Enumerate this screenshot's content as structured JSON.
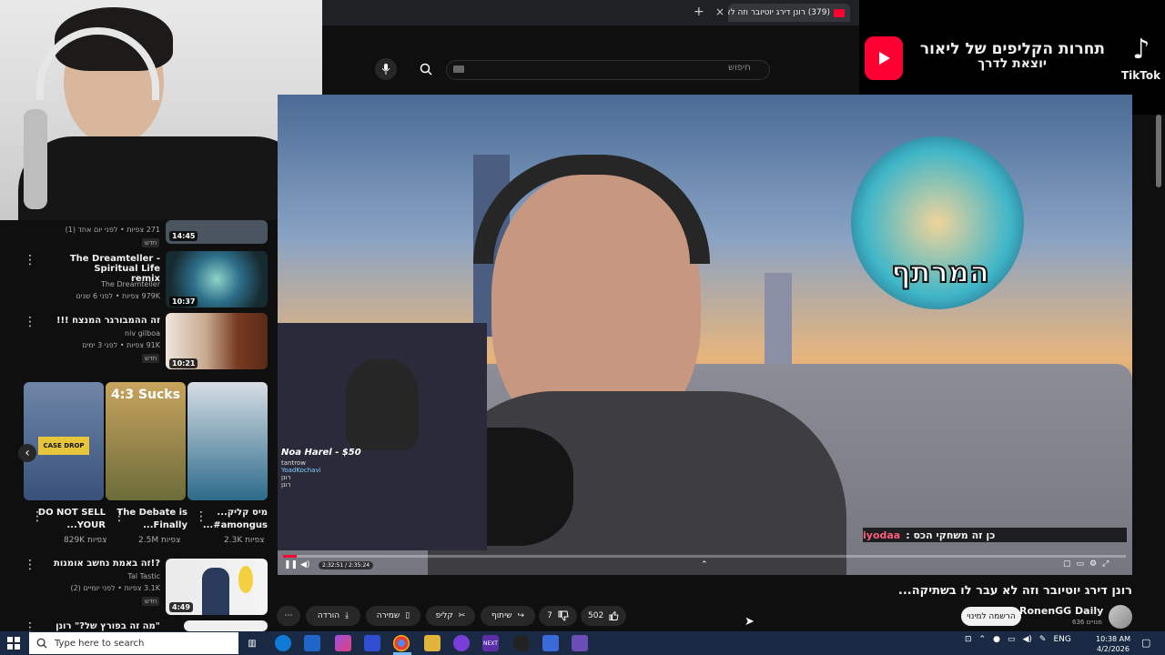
{
  "browser": {
    "tab_title": "(379) רונן דירג יוטיובר וזה לא",
    "tab_close": "×",
    "new_tab": "+"
  },
  "search": {
    "placeholder": "חיפוש"
  },
  "banner": {
    "line1": "תחרות הקליפים של ליאור",
    "line2": "יוצאת לדרך",
    "tiktok_label": "TikTok"
  },
  "sidebar": {
    "top_item": {
      "meta": "271 צפיות • לפני יום אחד (1)",
      "badge": "חדש",
      "duration": "14:45"
    },
    "items": [
      {
        "title_line1": "The Dreamteller - Spiritual Life",
        "title_line2": "remix",
        "channel": "The Dreamteller",
        "meta": "979K צפיות • לפני 6 שנים",
        "duration": "10:37"
      },
      {
        "title": "זה ההמבורגר המנצח !!!",
        "channel": "niv gilboa",
        "meta": "91K צפיות • לפני 3 ימים",
        "badge": "חדש",
        "duration": "10:21"
      },
      {
        "title": "?!זה באמת נחשב אומנות",
        "channel": "Tal Tastic",
        "meta": "3.1K צפיות • לפני יומיים (2)",
        "badge": "חדש",
        "duration": "4:49"
      },
      {
        "title": "\"מה זה בפורץ של?\" רונן מגיב"
      }
    ],
    "shorts": [
      {
        "title": "DO NOT SELL YOUR...",
        "views": "829K צפיות",
        "thumb_text": "CASE DROP"
      },
      {
        "title": "The Debate is Finally...",
        "views": "2.5M צפיות",
        "thumb_text": "4:3 Sucks"
      },
      {
        "title": "מיס קליק... amongus#...",
        "views": "2.3K צפיות",
        "thumb_text": ""
      }
    ],
    "shorts_prev": "‹"
  },
  "video": {
    "title": "רונן דירג יוטיובר וזה לא עבר לו בשתיקה...",
    "donation": "Noa Harel - $50",
    "mini_chat": [
      "tantrow",
      "YoadKochavi",
      "רונן",
      "רונן"
    ],
    "chat_user": "iyodaa",
    "chat_message": "כן זה משחקי הכס :",
    "time": "2:32:51 / 2:35:24",
    "progress_fraction": 0.016,
    "overlay_logo_text": "המרתף"
  },
  "channel": {
    "name": "RonenGG Daily",
    "subs": "636 מנויים",
    "subscribe_label": "הרשמה למינוי"
  },
  "actions": {
    "likes": "502",
    "dislikes": "7",
    "share": "שיתוף",
    "clip": "קליפ",
    "save": "שמירה",
    "download": "הורדה",
    "more": "⋯"
  },
  "taskbar": {
    "search_placeholder": "Type here to search",
    "lang": "ENG",
    "time": "10:38 AM",
    "date": "4/2/2026"
  },
  "colors": {
    "accent": "#ff0033",
    "bg": "#0f0f0f",
    "taskbar": "#1b2a44"
  }
}
